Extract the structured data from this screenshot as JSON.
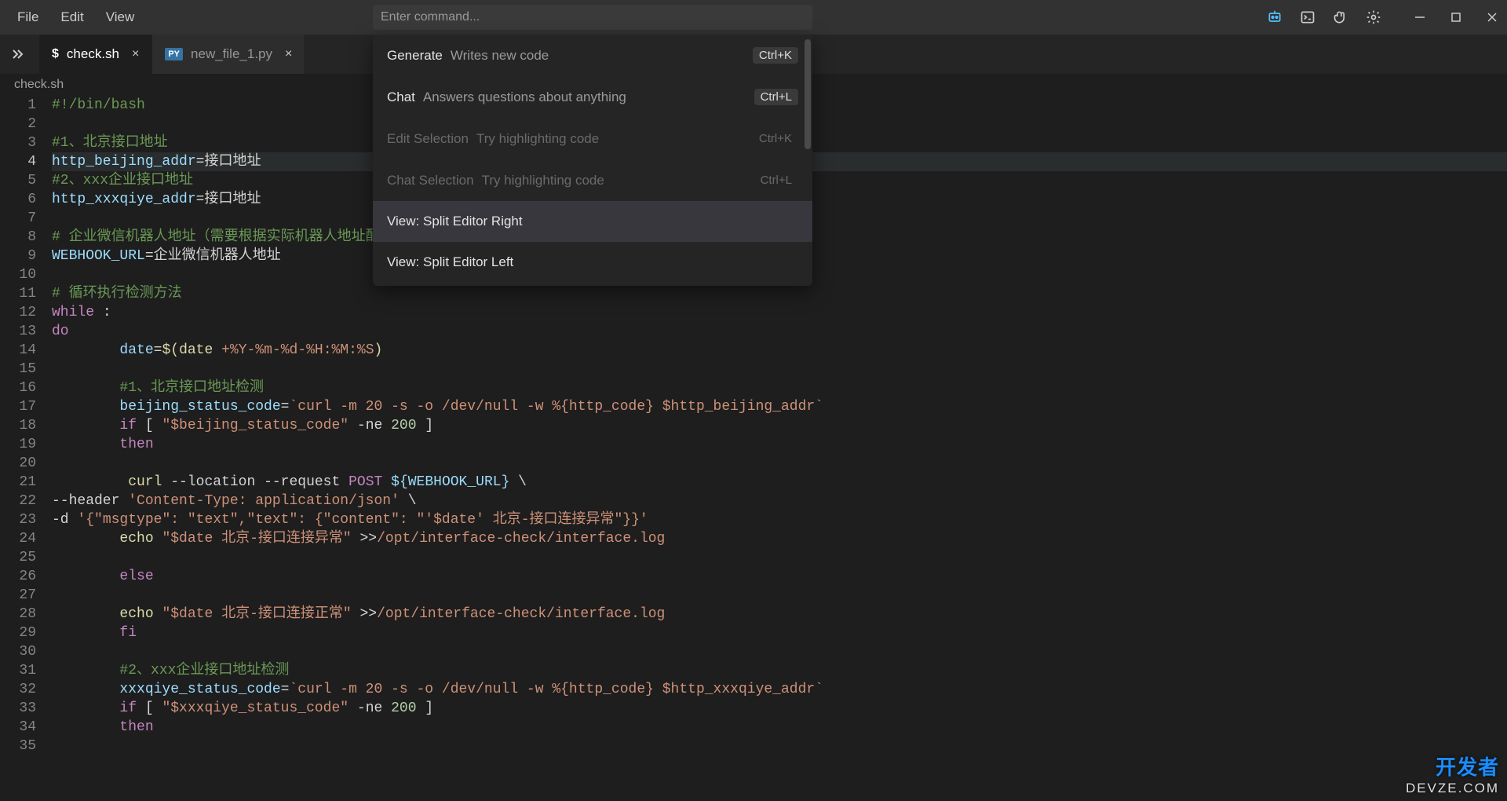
{
  "menu": {
    "file": "File",
    "edit": "Edit",
    "view": "View"
  },
  "command_input": {
    "placeholder": "Enter command..."
  },
  "tabs": [
    {
      "icon": "$",
      "label": "check.sh",
      "active": true
    },
    {
      "icon": "PY",
      "label": "new_file_1.py",
      "active": false
    }
  ],
  "breadcrumb": "check.sh",
  "palette": [
    {
      "label": "Generate",
      "desc": "Writes new code",
      "key": "Ctrl+K",
      "disabled": false,
      "hl": false
    },
    {
      "label": "Chat",
      "desc": "Answers questions about anything",
      "key": "Ctrl+L",
      "disabled": false,
      "hl": false
    },
    {
      "label": "Edit Selection",
      "desc": "Try highlighting code",
      "key": "Ctrl+K",
      "disabled": true,
      "hl": false
    },
    {
      "label": "Chat Selection",
      "desc": "Try highlighting code",
      "key": "Ctrl+L",
      "disabled": true,
      "hl": false
    },
    {
      "label": "View: Split Editor Right",
      "desc": "",
      "key": "",
      "disabled": false,
      "hl": true
    },
    {
      "label": "View: Split Editor Left",
      "desc": "",
      "key": "",
      "disabled": false,
      "hl": false
    }
  ],
  "current_line": 4,
  "code": {
    "1": [
      [
        "comment",
        "#!/bin/bash"
      ]
    ],
    "2": [],
    "3": [
      [
        "comment",
        "#1、北京接口地址"
      ]
    ],
    "4": [
      [
        "var",
        "http_beijing_addr"
      ],
      [
        "op",
        "="
      ],
      [
        "white",
        "接口地址"
      ]
    ],
    "5": [
      [
        "comment",
        "#2、xxx企业接口地址"
      ]
    ],
    "6": [
      [
        "var",
        "http_xxxqiye_addr"
      ],
      [
        "op",
        "="
      ],
      [
        "white",
        "接口地址"
      ]
    ],
    "7": [],
    "8": [
      [
        "comment",
        "# 企业微信机器人地址（需要根据实际机器人地址配置）"
      ]
    ],
    "9": [
      [
        "var",
        "WEBHOOK_URL"
      ],
      [
        "op",
        "="
      ],
      [
        "white",
        "企业微信机器人地址"
      ]
    ],
    "10": [],
    "11": [
      [
        "comment",
        "# 循环执行检测方法"
      ]
    ],
    "12": [
      [
        "kw",
        "while"
      ],
      [
        "white",
        " :"
      ]
    ],
    "13": [
      [
        "kw",
        "do"
      ]
    ],
    "14": [
      [
        "white",
        "        "
      ],
      [
        "var",
        "date"
      ],
      [
        "op",
        "="
      ],
      [
        "cmd",
        "$("
      ],
      [
        "cmd",
        "date"
      ],
      [
        "white",
        " "
      ],
      [
        "str",
        "+%Y-%m-%d-%H:%M:%S"
      ],
      [
        "cmd",
        ")"
      ]
    ],
    "15": [],
    "16": [
      [
        "white",
        "        "
      ],
      [
        "comment",
        "#1、北京接口地址检测"
      ]
    ],
    "17": [
      [
        "white",
        "        "
      ],
      [
        "var",
        "beijing_status_code"
      ],
      [
        "op",
        "="
      ],
      [
        "str",
        "`curl -m 20 -s -o /dev/null -w %{http_code} $http_beijing_addr`"
      ]
    ],
    "18": [
      [
        "white",
        "        "
      ],
      [
        "kw",
        "if"
      ],
      [
        "white",
        " [ "
      ],
      [
        "str",
        "\"$beijing_status_code\""
      ],
      [
        "white",
        " "
      ],
      [
        "op",
        "-ne"
      ],
      [
        "white",
        " "
      ],
      [
        "num",
        "200"
      ],
      [
        "white",
        " ]"
      ]
    ],
    "19": [
      [
        "white",
        "        "
      ],
      [
        "kw",
        "then"
      ]
    ],
    "20": [],
    "21": [
      [
        "white",
        "         "
      ],
      [
        "cmd",
        "curl"
      ],
      [
        "white",
        " "
      ],
      [
        "op",
        "--location --request"
      ],
      [
        "white",
        " "
      ],
      [
        "kw",
        "POST"
      ],
      [
        "white",
        " "
      ],
      [
        "var",
        "${WEBHOOK_URL}"
      ],
      [
        "white",
        " \\"
      ]
    ],
    "22": [
      [
        "op",
        "--header"
      ],
      [
        "white",
        " "
      ],
      [
        "str",
        "'Content-Type: application/json'"
      ],
      [
        "white",
        " \\"
      ]
    ],
    "23": [
      [
        "op",
        "-d"
      ],
      [
        "white",
        " "
      ],
      [
        "str",
        "'{\"msgtype\": \"text\",\"text\": {\"content\": \"'$date' 北京-接口连接异常\"}}'"
      ]
    ],
    "24": [
      [
        "white",
        "        "
      ],
      [
        "cmd",
        "echo"
      ],
      [
        "white",
        " "
      ],
      [
        "str",
        "\"$date 北京-接口连接异常\""
      ],
      [
        "white",
        " "
      ],
      [
        "op",
        ">>"
      ],
      [
        "path",
        "/opt/interface-check/interface.log"
      ]
    ],
    "25": [],
    "26": [
      [
        "white",
        "        "
      ],
      [
        "kw",
        "else"
      ]
    ],
    "27": [],
    "28": [
      [
        "white",
        "        "
      ],
      [
        "cmd",
        "echo"
      ],
      [
        "white",
        " "
      ],
      [
        "str",
        "\"$date 北京-接口连接正常\""
      ],
      [
        "white",
        " "
      ],
      [
        "op",
        ">>"
      ],
      [
        "path",
        "/opt/interface-check/interface.log"
      ]
    ],
    "29": [
      [
        "white",
        "        "
      ],
      [
        "kw",
        "fi"
      ]
    ],
    "30": [],
    "31": [
      [
        "white",
        "        "
      ],
      [
        "comment",
        "#2、xxx企业接口地址检测"
      ]
    ],
    "32": [
      [
        "white",
        "        "
      ],
      [
        "var",
        "xxxqiye_status_code"
      ],
      [
        "op",
        "="
      ],
      [
        "str",
        "`curl -m 20 -s -o /dev/null -w %{http_code} $http_xxxqiye_addr`"
      ]
    ],
    "33": [
      [
        "white",
        "        "
      ],
      [
        "kw",
        "if"
      ],
      [
        "white",
        " [ "
      ],
      [
        "str",
        "\"$xxxqiye_status_code\""
      ],
      [
        "white",
        " "
      ],
      [
        "op",
        "-ne"
      ],
      [
        "white",
        " "
      ],
      [
        "num",
        "200"
      ],
      [
        "white",
        " ]"
      ]
    ],
    "34": [
      [
        "white",
        "        "
      ],
      [
        "kw",
        "then"
      ]
    ],
    "35": []
  },
  "watermark": {
    "top": "开发者",
    "bottom": "DEVZE.COM"
  }
}
